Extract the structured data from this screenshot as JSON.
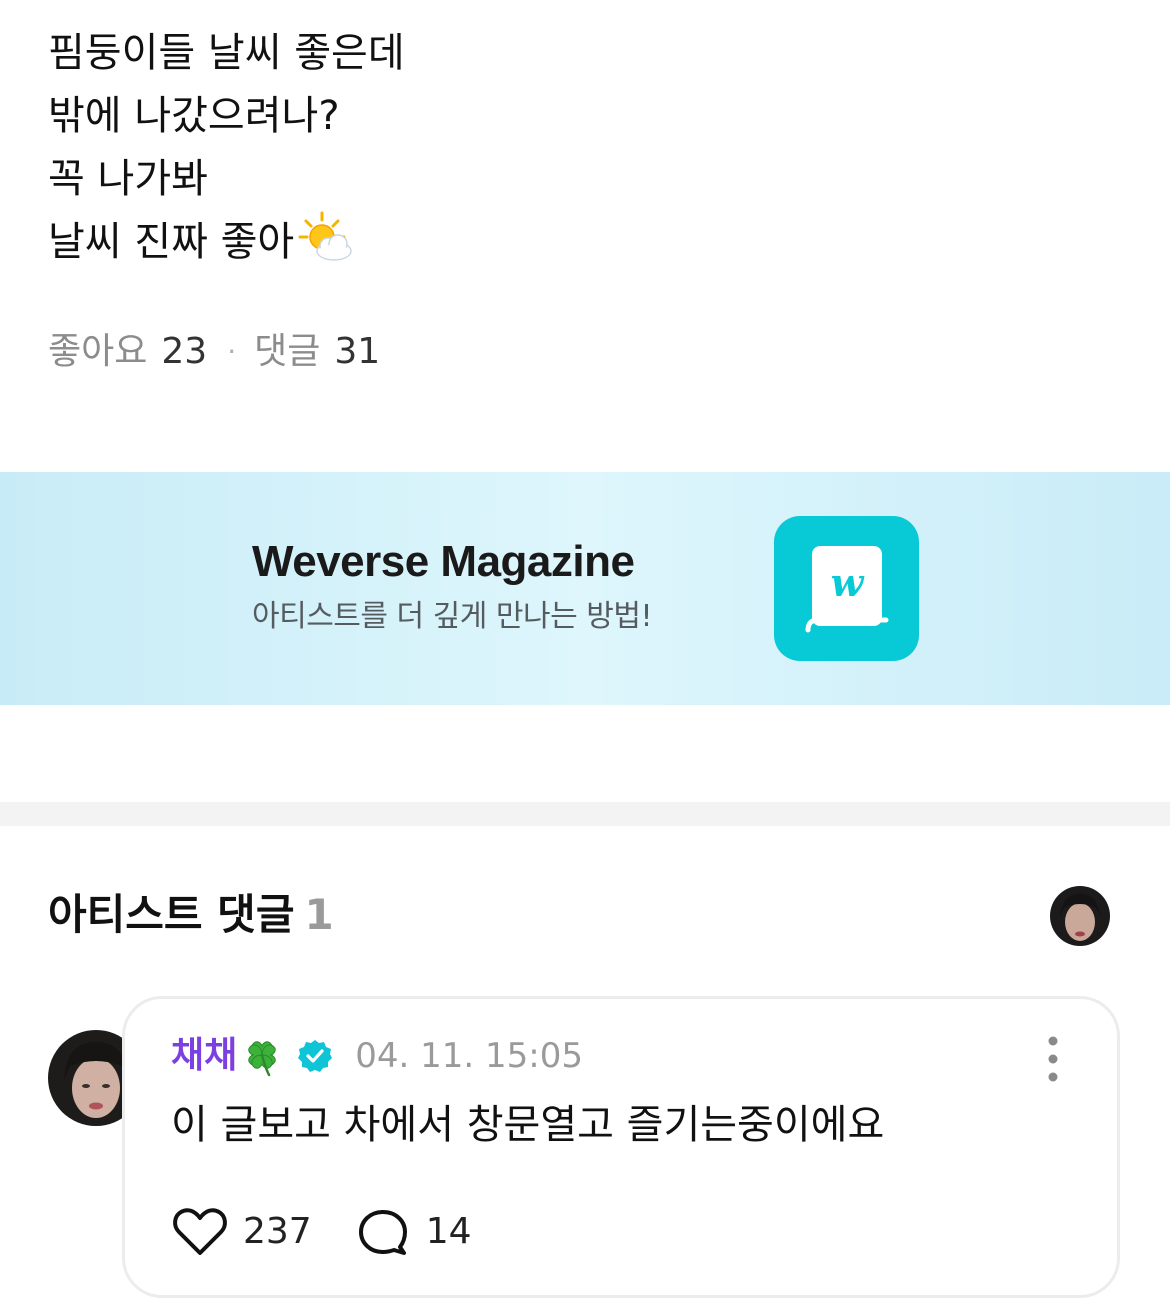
{
  "post": {
    "lines": [
      "핌둥이들 날씨 좋은데",
      "밖에 나갔으려나?",
      "꼭 나가봐",
      "날씨 진짜 좋아"
    ],
    "trailing_emoji": "sun-behind-cloud-icon",
    "likes_label": "좋아요",
    "likes_count": "23",
    "separator": "·",
    "comments_label": "댓글",
    "comments_count": "31"
  },
  "banner": {
    "title": "Weverse Magazine",
    "subtitle": "아티스트를 더 깊게 만나는 방법!",
    "icon": "weverse-magazine-book-icon",
    "icon_color": "#08c9d6"
  },
  "artist_comments": {
    "title": "아티스트 댓글",
    "count": "1",
    "comments": [
      {
        "author": "채채",
        "author_color": "#7c3fe0",
        "badge_emoji": "four-leaf-clover-icon",
        "verified": "verified-badge-icon",
        "time": "04. 11. 15:05",
        "text": "이 글보고 차에서 창문열고 즐기는중이에요",
        "likes": "237",
        "replies": "14"
      }
    ]
  }
}
